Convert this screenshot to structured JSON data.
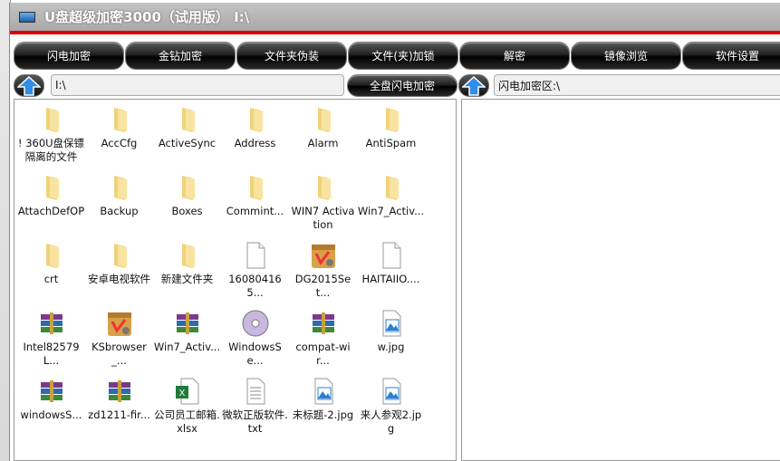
{
  "window": {
    "title": "U盘超级加密3000（试用版） I:\\"
  },
  "toolbar": [
    "闪电加密",
    "金钻加密",
    "文件夹伪装",
    "文件(夹)加锁",
    "解密",
    "镜像浏览",
    "软件设置"
  ],
  "left_path": "I:\\",
  "full_disk_button": "全盘闪电加密",
  "right_path": "闪电加密区:\\",
  "files": [
    {
      "name": "! 360U盘保镖隔离的文件",
      "icon": "folder"
    },
    {
      "name": "AccCfg",
      "icon": "folder"
    },
    {
      "name": "ActiveSync",
      "icon": "folder"
    },
    {
      "name": "Address",
      "icon": "folder"
    },
    {
      "name": "Alarm",
      "icon": "folder"
    },
    {
      "name": "AntiSpam",
      "icon": "folder"
    },
    {
      "name": "AttachDefOP",
      "icon": "folder"
    },
    {
      "name": "Backup",
      "icon": "folder"
    },
    {
      "name": "Boxes",
      "icon": "folder"
    },
    {
      "name": "Commint...",
      "icon": "folder"
    },
    {
      "name": "WIN7 Activation",
      "icon": "folder"
    },
    {
      "name": "Win7_Activ...",
      "icon": "folder"
    },
    {
      "name": "crt",
      "icon": "folder"
    },
    {
      "name": "安卓电视软件",
      "icon": "folder"
    },
    {
      "name": "新建文件夹",
      "icon": "folder"
    },
    {
      "name": "160804165...",
      "icon": "file"
    },
    {
      "name": "DG2015Set...",
      "icon": "setup"
    },
    {
      "name": "HAITAIIO....",
      "icon": "file"
    },
    {
      "name": "Intel82579L...",
      "icon": "archive"
    },
    {
      "name": "KSbrowser_...",
      "icon": "setup"
    },
    {
      "name": "Win7_Activ...",
      "icon": "archive"
    },
    {
      "name": "WindowsSe...",
      "icon": "disc"
    },
    {
      "name": "compat-wir...",
      "icon": "archive"
    },
    {
      "name": "w.jpg",
      "icon": "image"
    },
    {
      "name": "windowsS...",
      "icon": "archive"
    },
    {
      "name": "zd1211-fir...",
      "icon": "archive"
    },
    {
      "name": "公司员工邮箱.xlsx",
      "icon": "excel"
    },
    {
      "name": "微软正版软件.txt",
      "icon": "text"
    },
    {
      "name": "未标题-2.jpg",
      "icon": "image"
    },
    {
      "name": "来人参观2.jpg",
      "icon": "image"
    }
  ]
}
